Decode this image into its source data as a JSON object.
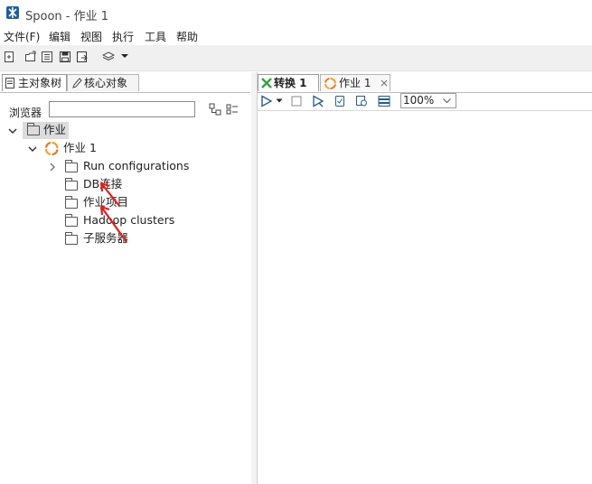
{
  "window": {
    "title": "Spoon - 作业 1"
  },
  "menu": [
    "文件(F)",
    "编辑",
    "视图",
    "执行",
    "工具",
    "帮助"
  ],
  "left_tabs": {
    "main": "主对象树",
    "core": "核心对象"
  },
  "browser": {
    "label": "浏览器",
    "search_value": ""
  },
  "tree": {
    "root": "作业",
    "job": "作业 1",
    "items": [
      "Run configurations",
      "DB连接",
      "作业项目",
      "Hadoop clusters",
      "子服务器"
    ]
  },
  "right_tabs": {
    "trans": "转换 1",
    "job": "作业 1"
  },
  "zoom": {
    "value": "100%"
  },
  "colors": {
    "annotation_arrow": "#e02020",
    "job_icon": "#f0a030",
    "trans_icon": "#3aa040"
  }
}
